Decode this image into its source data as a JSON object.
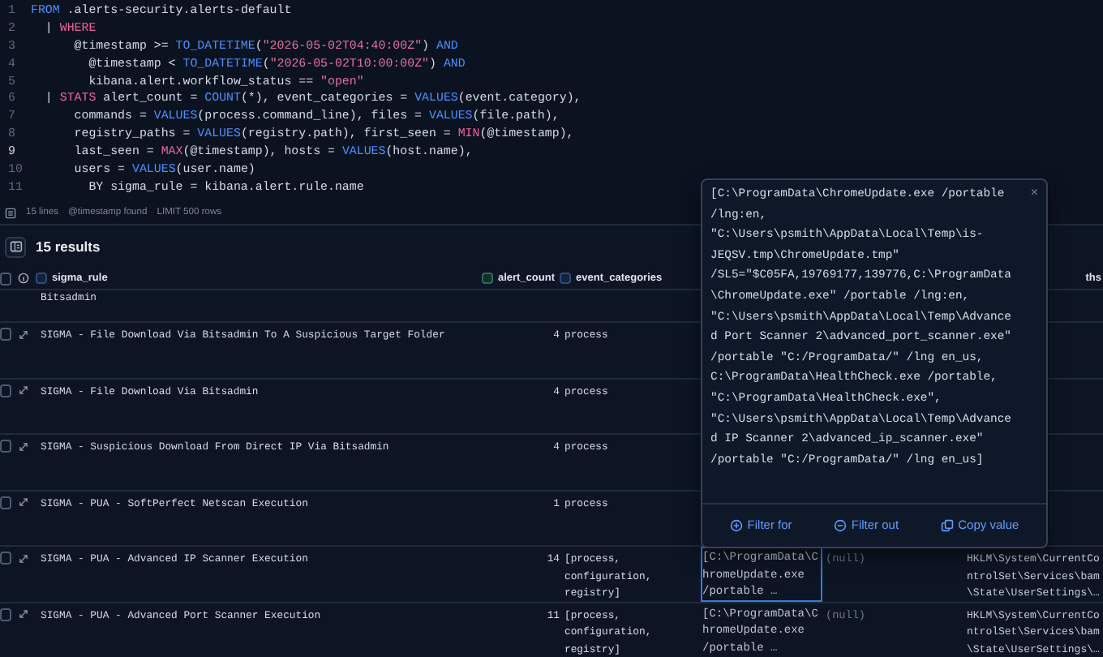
{
  "editor": {
    "lines": [
      {
        "number": "1",
        "current": false,
        "tokens": [
          {
            "kind": "keyword",
            "text": "FROM"
          },
          {
            "kind": "plain",
            "text": " .alerts-security.alerts-default"
          }
        ]
      },
      {
        "number": "2",
        "current": false,
        "tokens": [
          {
            "kind": "plain",
            "text": "  | "
          },
          {
            "kind": "command",
            "text": "WHERE"
          }
        ]
      },
      {
        "number": "3",
        "current": false,
        "tokens": [
          {
            "kind": "plain",
            "text": "      @timestamp >= "
          },
          {
            "kind": "keyword",
            "text": "TO_DATETIME"
          },
          {
            "kind": "plain",
            "text": "("
          },
          {
            "kind": "string",
            "text": "\"2026-05-02T04:40:00Z\""
          },
          {
            "kind": "plain",
            "text": ") "
          },
          {
            "kind": "keyword",
            "text": "AND"
          }
        ]
      },
      {
        "number": "4",
        "current": false,
        "tokens": [
          {
            "kind": "plain",
            "text": "        @timestamp < "
          },
          {
            "kind": "keyword",
            "text": "TO_DATETIME"
          },
          {
            "kind": "plain",
            "text": "("
          },
          {
            "kind": "string",
            "text": "\"2026-05-02T10:00:00Z\""
          },
          {
            "kind": "plain",
            "text": ") "
          },
          {
            "kind": "keyword",
            "text": "AND"
          }
        ]
      },
      {
        "number": "5",
        "current": false,
        "tokens": [
          {
            "kind": "plain",
            "text": "        kibana.alert.workflow_status == "
          },
          {
            "kind": "string",
            "text": "\"open\""
          }
        ]
      },
      {
        "number": "6",
        "current": false,
        "tokens": [
          {
            "kind": "plain",
            "text": "  | "
          },
          {
            "kind": "command",
            "text": "STATS"
          },
          {
            "kind": "plain",
            "text": " alert_count = "
          },
          {
            "kind": "keyword",
            "text": "COUNT"
          },
          {
            "kind": "plain",
            "text": "(*), event_categories = "
          },
          {
            "kind": "keyword",
            "text": "VALUES"
          },
          {
            "kind": "plain",
            "text": "(event.category),"
          }
        ]
      },
      {
        "number": "7",
        "current": false,
        "tokens": [
          {
            "kind": "plain",
            "text": "      commands = "
          },
          {
            "kind": "keyword",
            "text": "VALUES"
          },
          {
            "kind": "plain",
            "text": "(process.command_line), files = "
          },
          {
            "kind": "keyword",
            "text": "VALUES"
          },
          {
            "kind": "plain",
            "text": "(file.path),"
          }
        ]
      },
      {
        "number": "8",
        "current": false,
        "tokens": [
          {
            "kind": "plain",
            "text": "      registry_paths = "
          },
          {
            "kind": "keyword",
            "text": "VALUES"
          },
          {
            "kind": "plain",
            "text": "(registry.path), first_seen = "
          },
          {
            "kind": "command",
            "text": "MIN"
          },
          {
            "kind": "plain",
            "text": "(@timestamp),"
          }
        ]
      },
      {
        "number": "9",
        "current": true,
        "tokens": [
          {
            "kind": "plain",
            "text": "      last_seen = "
          },
          {
            "kind": "command",
            "text": "MAX"
          },
          {
            "kind": "plain",
            "text": "(@timestamp), hosts = "
          },
          {
            "kind": "keyword",
            "text": "VALUES"
          },
          {
            "kind": "plain",
            "text": "(host.name),"
          }
        ]
      },
      {
        "number": "10",
        "current": false,
        "tokens": [
          {
            "kind": "plain",
            "text": "      users = "
          },
          {
            "kind": "keyword",
            "text": "VALUES"
          },
          {
            "kind": "plain",
            "text": "(user.name)"
          }
        ]
      },
      {
        "number": "11",
        "current": false,
        "tokens": [
          {
            "kind": "plain",
            "text": "        BY sigma_rule = kibana.alert.rule.name"
          }
        ]
      }
    ]
  },
  "status_bar": [
    "15 lines",
    "@timestamp found",
    "LIMIT 500 rows"
  ],
  "results": {
    "count_label": "15 results",
    "select_all_checked": false,
    "columns": [
      {
        "kind": "text",
        "label": "sigma_rule"
      },
      {
        "kind": "number",
        "label": "alert_count"
      },
      {
        "kind": "text",
        "label": "event_categories"
      },
      {
        "kind": "cut",
        "label": "ths"
      }
    ],
    "rows": [
      {
        "kind": "partial",
        "sigma_rule": "Bitsadmin"
      },
      {
        "kind": "full",
        "checked": false,
        "sigma_rule": "SIGMA - File Download Via Bitsadmin To A Suspicious Target Folder",
        "alert_count": "4",
        "event_categories": "process"
      },
      {
        "kind": "full",
        "checked": false,
        "sigma_rule": "SIGMA - File Download Via Bitsadmin",
        "alert_count": "4",
        "event_categories": "process"
      },
      {
        "kind": "full",
        "checked": false,
        "sigma_rule": "SIGMA - Suspicious Download From Direct IP Via Bitsadmin",
        "alert_count": "4",
        "event_categories": "process"
      },
      {
        "kind": "full",
        "checked": false,
        "sigma_rule": "SIGMA - PUA - SoftPerfect Netscan Execution",
        "alert_count": "1",
        "event_categories": "process"
      },
      {
        "kind": "full",
        "checked": false,
        "sigma_rule": "SIGMA - PUA - Advanced IP Scanner Execution",
        "alert_count": "14",
        "event_categories": "[process, configuration, registry]",
        "column_6": "[C:\\ProgramData\\ChromeUpdate.exe /portable …",
        "column_6_focused": true,
        "column_7": "(null)",
        "column_8": "HKLM\\System\\CurrentControlSet\\Services\\bam\\State\\UserSettings\\…"
      },
      {
        "kind": "full",
        "checked": false,
        "sigma_rule": "SIGMA - PUA - Advanced Port Scanner Execution",
        "alert_count": "11",
        "event_categories": "[process, configuration, registry]",
        "column_6": "[C:\\ProgramData\\ChromeUpdate.exe /portable …",
        "column_6_focused": false,
        "column_7": "(null)",
        "column_8": "HKLM\\System\\CurrentControlSet\\Services\\bam\\State\\UserSettings\\…"
      }
    ]
  },
  "popover": {
    "value": "[C:\\ProgramData\\ChromeUpdate.exe /portable /lng:en, \"C:\\Users\\psmith\\AppData\\Local\\Temp\\is-JEQSV.tmp\\ChromeUpdate.tmp\" /SL5=\"$C05FA,19769177,139776,C:\\ProgramData\\ChromeUpdate.exe\" /portable /lng:en, \"C:\\Users\\psmith\\AppData\\Local\\Temp\\Advanced Port Scanner 2\\advanced_port_scanner.exe\" /portable \"C:/ProgramData/\" /lng en_us, C:\\ProgramData\\HealthCheck.exe /portable, \"C:\\ProgramData\\HealthCheck.exe\", \"C:\\Users\\psmith\\AppData\\Local\\Temp\\Advanced IP Scanner 2\\advanced_ip_scanner.exe\" /portable \"C:/ProgramData/\" /lng en_us]",
    "close": "×",
    "actions": [
      {
        "kind": "filter-for",
        "label": "Filter for"
      },
      {
        "kind": "filter-out",
        "label": "Filter out"
      },
      {
        "kind": "copy",
        "label": "Copy value"
      }
    ]
  }
}
